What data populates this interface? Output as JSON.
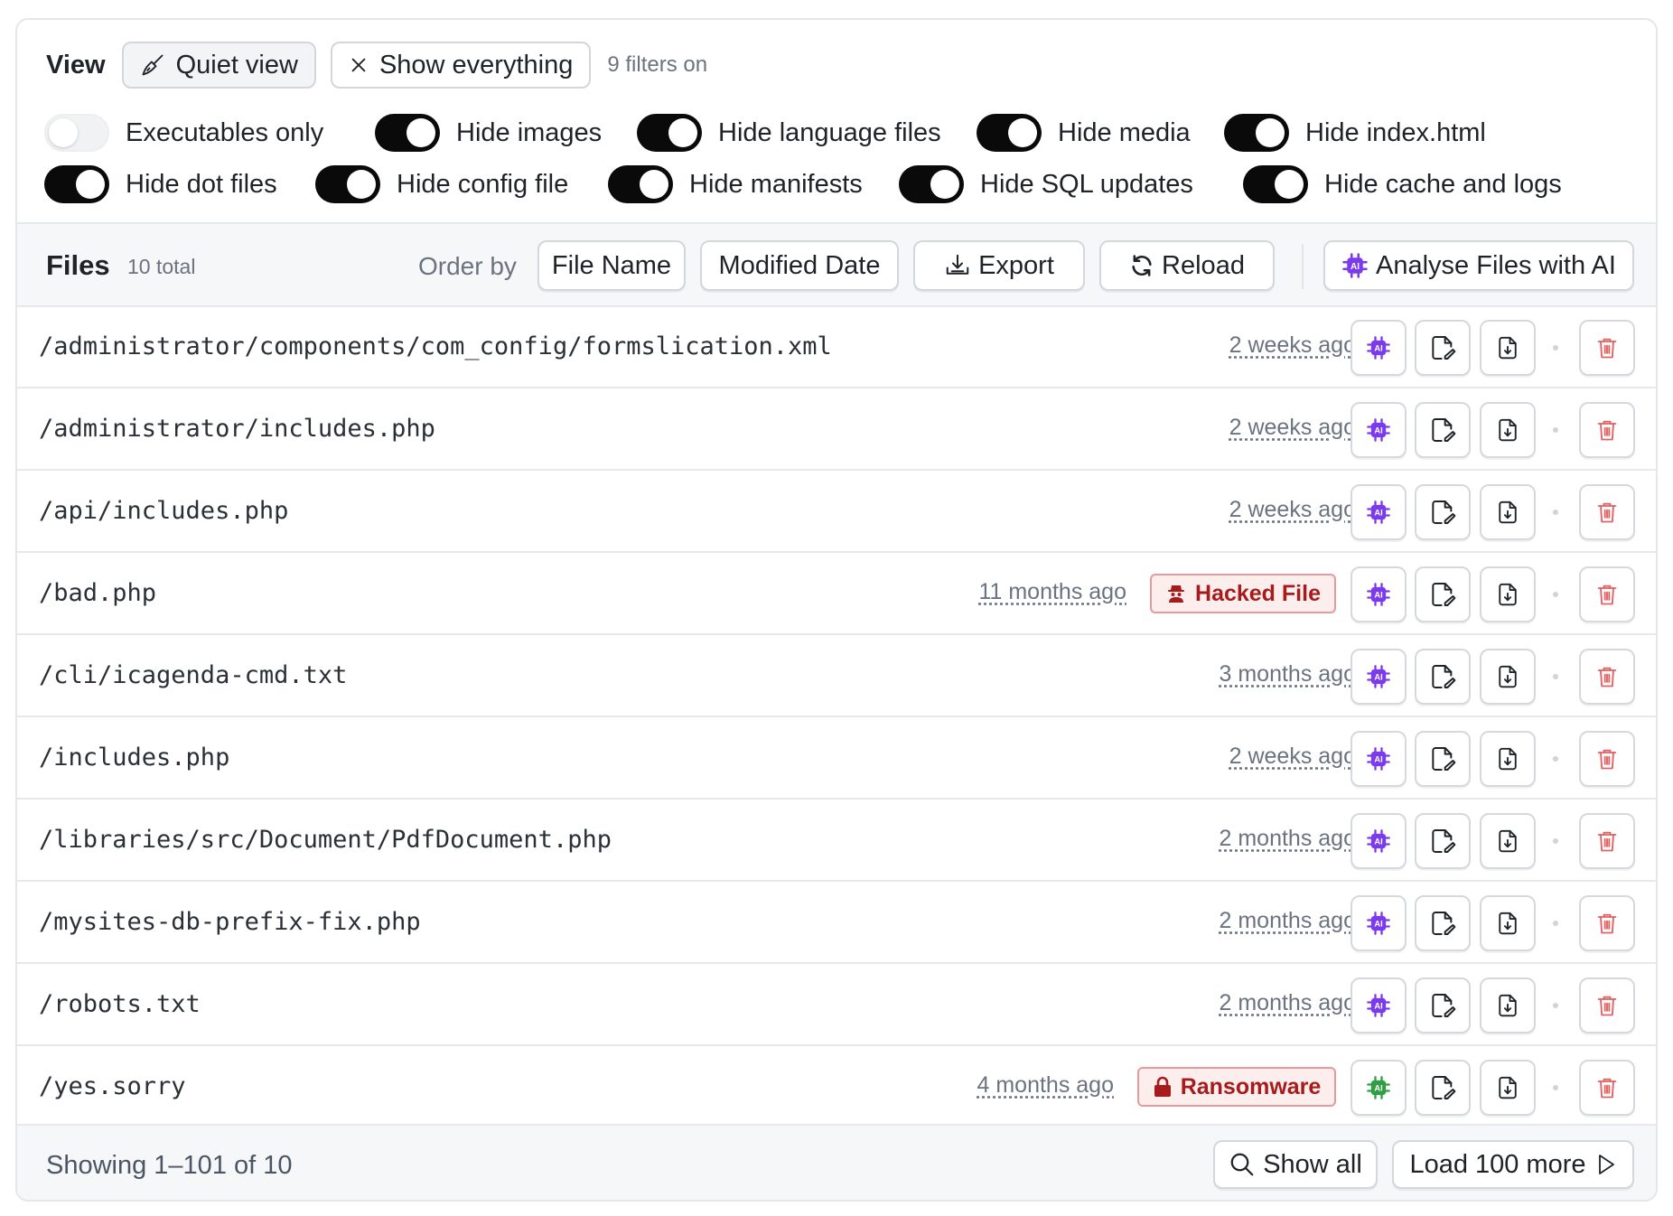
{
  "view": {
    "label": "View",
    "quiet_view": "Quiet view",
    "show_everything": "Show everything",
    "filters_on": "9 filters on"
  },
  "toggles": [
    {
      "label": "Executables only",
      "on": false
    },
    {
      "label": "Hide images",
      "on": true
    },
    {
      "label": "Hide language files",
      "on": true
    },
    {
      "label": "Hide media",
      "on": true
    },
    {
      "label": "Hide index.html",
      "on": true
    },
    {
      "label": "Hide dot files",
      "on": true
    },
    {
      "label": "Hide config file",
      "on": true
    },
    {
      "label": "Hide manifests",
      "on": true
    },
    {
      "label": "Hide SQL updates",
      "on": true
    },
    {
      "label": "Hide cache and logs",
      "on": true
    }
  ],
  "files": {
    "title": "Files",
    "total": "10 total",
    "order_by": "Order by",
    "sort_file_name": "File Name",
    "sort_modified": "Modified Date",
    "export": "Export",
    "reload": "Reload",
    "analyse": "Analyse Files with AI"
  },
  "rows": [
    {
      "path": "/administrator/components/com_config/formslication.xml",
      "date": "2 weeks ago",
      "badge": ""
    },
    {
      "path": "/administrator/includes.php",
      "date": "2 weeks ago",
      "badge": ""
    },
    {
      "path": "/api/includes.php",
      "date": "2 weeks ago",
      "badge": ""
    },
    {
      "path": "/bad.php",
      "date": "11 months ago",
      "badge": "Hacked File"
    },
    {
      "path": "/cli/icagenda-cmd.txt",
      "date": "3 months ago",
      "badge": ""
    },
    {
      "path": "/includes.php",
      "date": "2 weeks ago",
      "badge": ""
    },
    {
      "path": "/libraries/src/Document/PdfDocument.php",
      "date": "2 months ago",
      "badge": ""
    },
    {
      "path": "/mysites-db-prefix-fix.php",
      "date": "2 months ago",
      "badge": ""
    },
    {
      "path": "/robots.txt",
      "date": "2 months ago",
      "badge": ""
    },
    {
      "path": "/yes.sorry",
      "date": "4 months ago",
      "badge": "Ransomware"
    }
  ],
  "icons": {
    "ai": "ai-chip-icon",
    "edit": "file-edit-icon",
    "download": "file-download-icon",
    "delete": "trash-icon",
    "hacked": "spy-icon",
    "ransomware": "lock-icon"
  },
  "colors": {
    "ai_purple": "#7c3aed",
    "ai_green": "#2f9e44",
    "danger": "#a61b1b",
    "delete_red": "#e06262"
  },
  "footer": {
    "showing": "Showing 1–101 of 10",
    "show_all": "Show all",
    "load_more": "Load 100 more"
  }
}
